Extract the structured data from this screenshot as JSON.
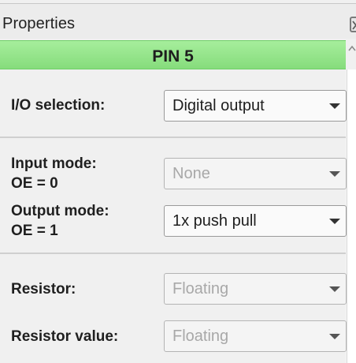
{
  "window": {
    "title": "Properties"
  },
  "header": {
    "pin_label": "PIN 5"
  },
  "fields": {
    "io_selection": {
      "label": "I/O selection:",
      "value": "Digital output"
    },
    "input_mode": {
      "label_line1": "Input mode:",
      "label_line2": "OE = 0",
      "value": "None"
    },
    "output_mode": {
      "label_line1": "Output mode:",
      "label_line2": "OE = 1",
      "value": "1x push pull"
    },
    "resistor": {
      "label": "Resistor:",
      "value": "Floating"
    },
    "resistor_value": {
      "label": "Resistor value:",
      "value": "Floating"
    }
  },
  "colors": {
    "header_green": "#8fe385",
    "disabled_text": "#a8a8a8"
  },
  "icons": {
    "close": "close-icon",
    "dropdown": "chevron-down-icon",
    "scroll_up": "scroll-up-icon"
  }
}
